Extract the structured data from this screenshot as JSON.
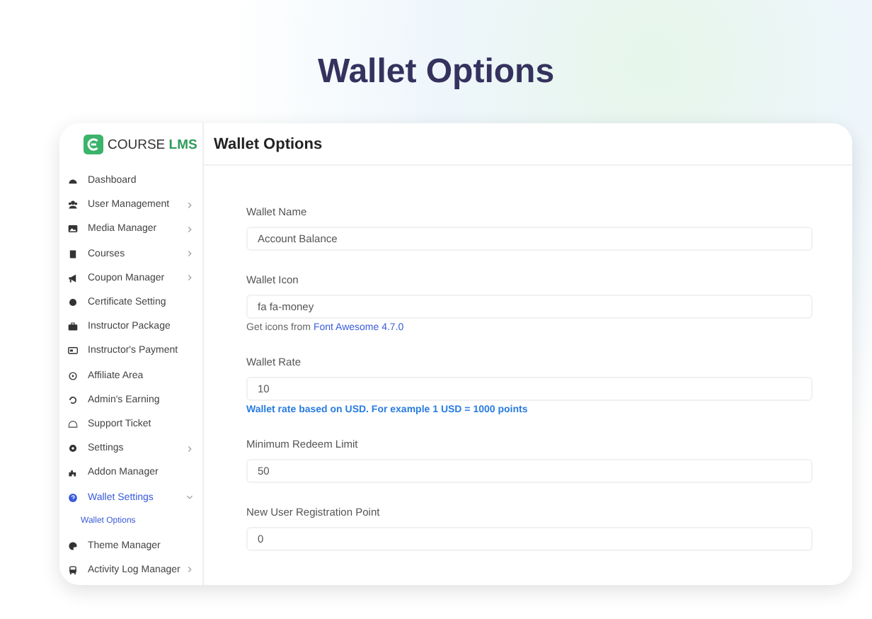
{
  "headline": "Wallet Options",
  "sidebar": {
    "logo": {
      "word1": "COURSE",
      "word2": "LMS"
    },
    "items": [
      {
        "label": "Dashboard",
        "submenu": false,
        "expanded": false,
        "selected": false
      },
      {
        "label": "User Management",
        "submenu": true,
        "expanded": false,
        "selected": false
      },
      {
        "label": "Media Manager",
        "submenu": true,
        "expanded": false,
        "selected": false
      },
      {
        "label": "Courses",
        "submenu": true,
        "expanded": false,
        "selected": false
      },
      {
        "label": "Coupon Manager",
        "submenu": true,
        "expanded": false,
        "selected": false
      },
      {
        "label": "Certificate Setting",
        "submenu": false,
        "expanded": false,
        "selected": false
      },
      {
        "label": "Instructor Package",
        "submenu": false,
        "expanded": false,
        "selected": false
      },
      {
        "label": "Instructor's Payment",
        "submenu": false,
        "expanded": false,
        "selected": false
      },
      {
        "label": "Affiliate Area",
        "submenu": false,
        "expanded": false,
        "selected": false
      },
      {
        "label": "Admin's Earning",
        "submenu": false,
        "expanded": false,
        "selected": false
      },
      {
        "label": "Support Ticket",
        "submenu": false,
        "expanded": false,
        "selected": false
      },
      {
        "label": "Settings",
        "submenu": true,
        "expanded": false,
        "selected": false
      },
      {
        "label": "Addon Manager",
        "submenu": false,
        "expanded": false,
        "selected": false
      },
      {
        "label": "Wallet Settings",
        "submenu": true,
        "expanded": true,
        "selected": true,
        "children": [
          {
            "label": "Wallet Options",
            "selected": true
          }
        ]
      },
      {
        "label": "Theme Manager",
        "submenu": false,
        "expanded": false,
        "selected": false
      },
      {
        "label": "Activity Log Manager",
        "submenu": true,
        "expanded": false,
        "selected": false
      }
    ]
  },
  "page": {
    "title": "Wallet Options",
    "fields": [
      {
        "label": "Wallet Name",
        "value": "Account Balance"
      },
      {
        "label": "Wallet Icon",
        "value": "fa fa-money",
        "help": {
          "text": "Get icons from",
          "link": "Font Awesome 4.7.0"
        }
      },
      {
        "label": "Wallet Rate",
        "value": "10",
        "help": {
          "text": "Wallet rate based on USD. For example 1 USD = 1000 points",
          "highlight": true
        }
      },
      {
        "label": "Minimum Redeem Limit",
        "value": "50"
      },
      {
        "label": "New User Registration Point",
        "value": "0"
      }
    ]
  }
}
